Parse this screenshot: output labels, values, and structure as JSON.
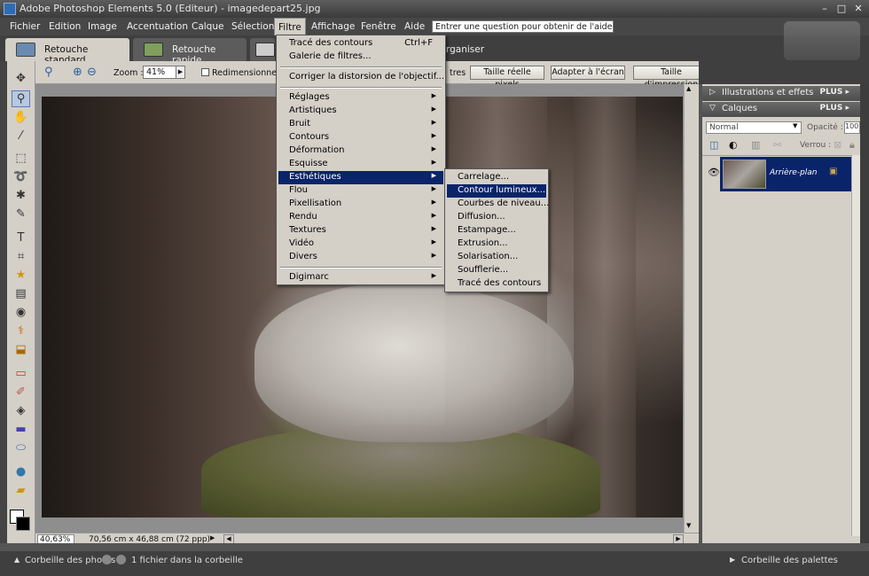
{
  "window": {
    "title": "Adobe Photoshop Elements 5.0 (Editeur) - imagedepart25.jpg"
  },
  "menubar": [
    "Fichier",
    "Edition",
    "Image",
    "Accentuation",
    "Calque",
    "Sélection",
    "Filtre",
    "Affichage",
    "Fenêtre",
    "Aide"
  ],
  "help": {
    "placeholder": "Entrer une question pour obtenir de l'aide"
  },
  "tabs": [
    "Retouche standard",
    "Retouche rapide"
  ],
  "tab_partial": "rganiser",
  "options": {
    "zoom_label": "Zoom :",
    "zoom_value": "41%",
    "resize_label": "Redimensionner le",
    "tres": "tres",
    "btn_actual": "Taille réelle pixels",
    "btn_fit": "Adapter à l'écran",
    "btn_print": "Taille d'impression"
  },
  "filter_menu": {
    "items": [
      "Tracé des contours",
      "Galerie de filtres...",
      "Corriger la distorsion de l'objectif...",
      "Réglages",
      "Artistiques",
      "Bruit",
      "Contours",
      "Déformation",
      "Esquisse",
      "Esthétiques",
      "Flou",
      "Pixellisation",
      "Rendu",
      "Textures",
      "Vidéo",
      "Divers",
      "Digimarc"
    ],
    "shortcut": "Ctrl+F"
  },
  "submenu": {
    "items": [
      "Carrelage...",
      "Contour lumineux...",
      "Courbes de niveau...",
      "Diffusion...",
      "Estampage...",
      "Extrusion...",
      "Solarisation...",
      "Soufflerie...",
      "Tracé des contours"
    ]
  },
  "status": {
    "zoom": "40,63%",
    "info": "70,56 cm x 46,88 cm (72 ppp)"
  },
  "panels": {
    "effects": "Illustrations et effets",
    "layers": "Calques",
    "plus": "PLUS",
    "blend_mode": "Normal",
    "opacity_label": "Opacité :",
    "opacity_value": "100",
    "lock_label": "Verrou :",
    "layer_name": "Arrière-plan"
  },
  "bottom": {
    "photo_bin": "Corbeille des photos",
    "bin_count": "1 fichier dans la corbeille",
    "palette_bin": "Corbeille des palettes"
  },
  "colors": {
    "highlight": "#0a246a",
    "panel": "#d4d0c8"
  }
}
